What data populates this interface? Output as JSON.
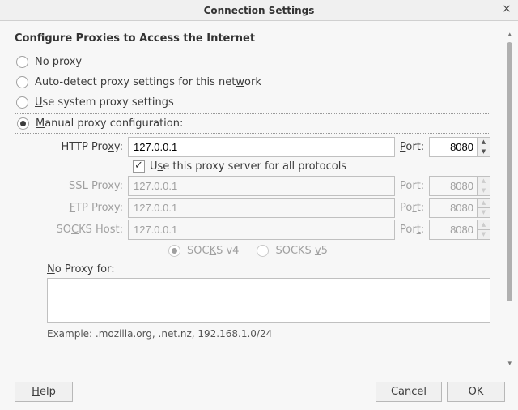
{
  "window": {
    "title": "Connection Settings",
    "close_icon": "×"
  },
  "heading": "Configure Proxies to Access the Internet",
  "radios": {
    "no_proxy": {
      "pre": "No pro",
      "u": "x",
      "post": "y"
    },
    "auto_detect": {
      "pre": "Auto-detect proxy settings for this net",
      "u": "w",
      "post": "ork"
    },
    "system": {
      "pre": "",
      "u": "U",
      "post": "se system proxy settings"
    },
    "manual": {
      "pre": "",
      "u": "M",
      "post": "anual proxy configuration:"
    }
  },
  "proxies": {
    "http": {
      "label_pre": "HTTP Pro",
      "label_u": "x",
      "label_post": "y:",
      "host": "127.0.0.1",
      "port_u": "P",
      "port_post": "ort:",
      "port": "8080"
    },
    "use_all": {
      "pre": "U",
      "u": "s",
      "post": "e this proxy server for all protocols"
    },
    "ssl": {
      "label_pre": "SS",
      "label_u": "L",
      "label_post": " Proxy:",
      "host": "127.0.0.1",
      "port_pre": "P",
      "port_u": "o",
      "port_post": "rt:",
      "port": "8080"
    },
    "ftp": {
      "label_pre": "",
      "label_u": "F",
      "label_post": "TP Proxy:",
      "host": "127.0.0.1",
      "port_pre": "Po",
      "port_u": "r",
      "port_post": "t:",
      "port": "8080"
    },
    "socks": {
      "label_pre": "SO",
      "label_u": "C",
      "label_post": "KS Host:",
      "host": "127.0.0.1",
      "port_pre": "Por",
      "port_u": "t",
      "port_post": ":",
      "port": "8080"
    },
    "socks_v4": {
      "pre": "SOC",
      "u": "K",
      "post": "S v4"
    },
    "socks_v5": {
      "pre": "SOCKS ",
      "u": "v",
      "post": "5"
    }
  },
  "no_proxy_for": {
    "label_u": "N",
    "label_post": "o Proxy for:",
    "value": "",
    "example": "Example: .mozilla.org, .net.nz, 192.168.1.0/24"
  },
  "buttons": {
    "help_u": "H",
    "help_post": "elp",
    "cancel": "Cancel",
    "ok": "OK"
  }
}
